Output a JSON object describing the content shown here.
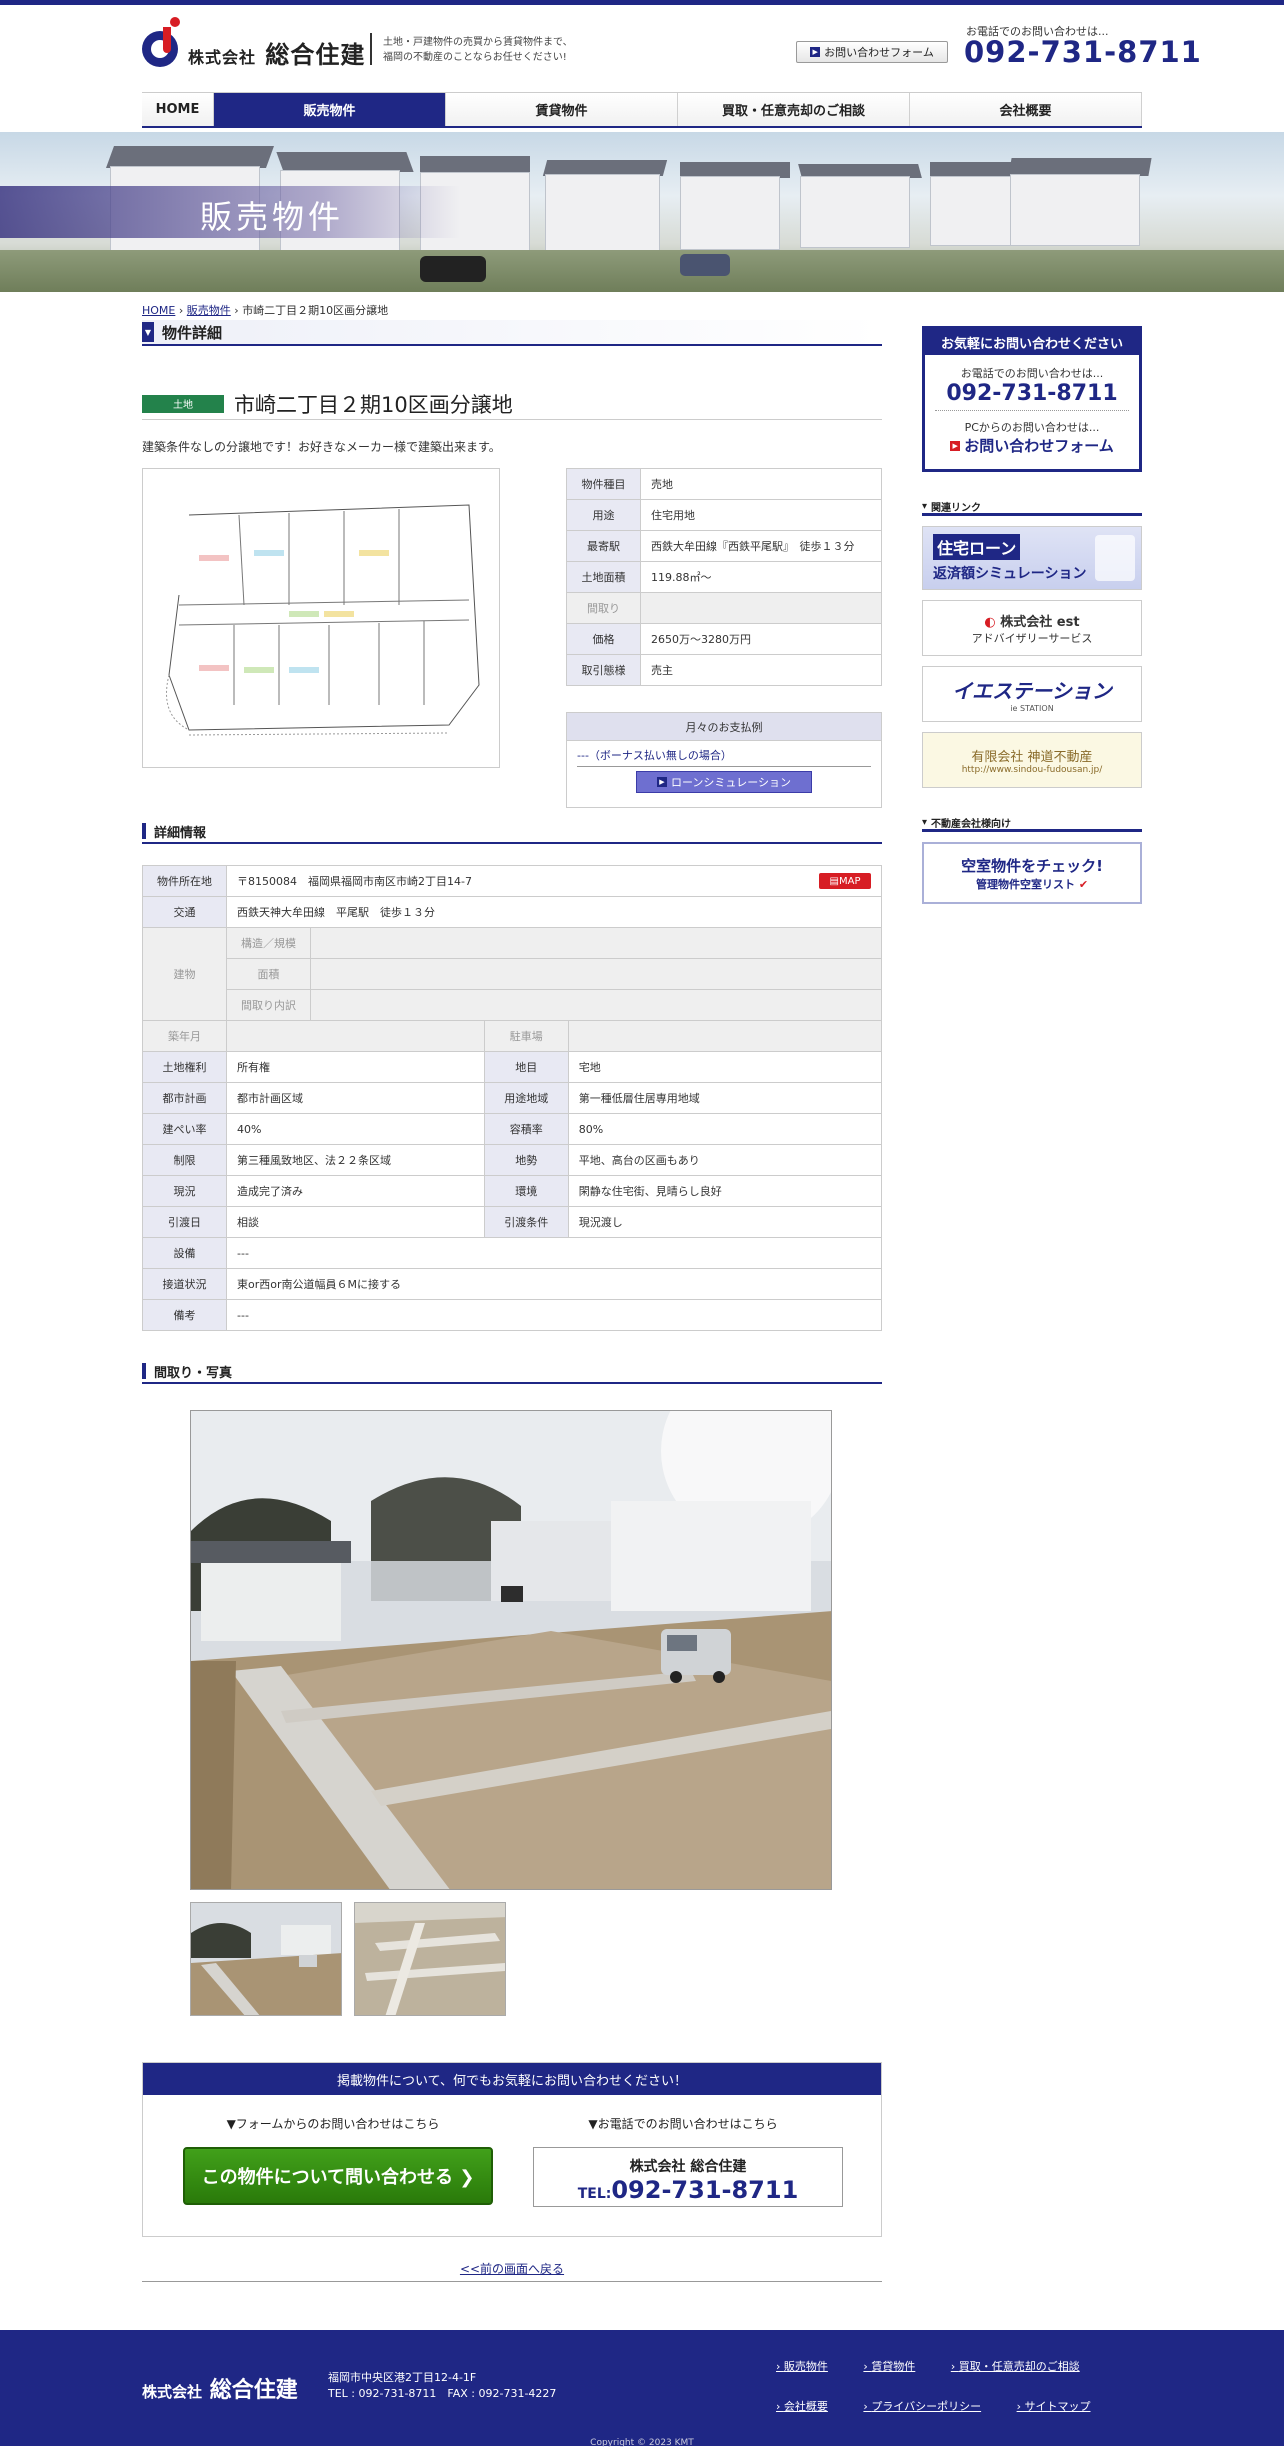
{
  "header": {
    "company_prefix": "株式会社",
    "company_name": "総合住建",
    "tagline_1": "土地・戸建物件の売買から賃貸物件まで、",
    "tagline_2": "福岡の不動産のことならお任せください!",
    "form_button": "お問い合わせフォーム",
    "tel_label": "お電話でのお問い合わせは...",
    "tel": "092-731-8711"
  },
  "nav": [
    {
      "label": "HOME",
      "active": false
    },
    {
      "label": "販売物件",
      "active": true
    },
    {
      "label": "賃貸物件",
      "active": false
    },
    {
      "label": "買取・任意売却のご相談",
      "active": false
    },
    {
      "label": "会社概要",
      "active": false
    }
  ],
  "hero": {
    "title": "販売物件"
  },
  "breadcrumb": {
    "home": "HOME",
    "category": "販売物件",
    "current": "市崎二丁目２期10区画分譲地",
    "sep": "›"
  },
  "section": {
    "title": "物件詳細"
  },
  "property": {
    "type_badge": "土地",
    "name": "市崎二丁目２期10区画分譲地",
    "catch": "建築条件なしの分譲地です！お好きなメーカー様で建築出来ます。"
  },
  "spec": [
    {
      "label": "物件種目",
      "value": "売地",
      "dim": false
    },
    {
      "label": "用途",
      "value": "住宅用地",
      "dim": false
    },
    {
      "label": "最寄駅",
      "value": "西鉄大牟田線『西鉄平尾駅』　徒歩１３分",
      "dim": false
    },
    {
      "label": "土地面積",
      "value": "119.88㎡～",
      "dim": false
    },
    {
      "label": "間取り",
      "value": "",
      "dim": true
    },
    {
      "label": "価格",
      "value": "2650万～3280万円",
      "dim": false
    },
    {
      "label": "取引態様",
      "value": "売主",
      "dim": false
    }
  ],
  "payment": {
    "title": "月々のお支払例",
    "row": "---（ボーナス払い無しの場合）",
    "button": "ローンシミュレーション"
  },
  "detail": {
    "title": "詳細情報",
    "address_label": "物件所在地",
    "address": "〒8150084　福岡県福岡市南区市崎2丁目14-7",
    "map_button": "MAP",
    "traffic_label": "交通",
    "traffic": "西鉄天神大牟田線　平尾駅　徒歩１３分",
    "building_label": "建物",
    "building_rows": [
      "構造／規模",
      "面積",
      "間取り内訳"
    ],
    "pairs": [
      {
        "l1": "築年月",
        "v1": "",
        "l2": "駐車場",
        "v2": "",
        "dim": true
      },
      {
        "l1": "土地権利",
        "v1": "所有権",
        "l2": "地目",
        "v2": "宅地",
        "dim": false
      },
      {
        "l1": "都市計画",
        "v1": "都市計画区域",
        "l2": "用途地域",
        "v2": "第一種低層住居専用地域",
        "dim": false
      },
      {
        "l1": "建ぺい率",
        "v1": "40%",
        "l2": "容積率",
        "v2": "80%",
        "dim": false
      },
      {
        "l1": "制限",
        "v1": "第三種風致地区、法２２条区域",
        "l2": "地勢",
        "v2": "平地、高台の区画もあり",
        "dim": false
      },
      {
        "l1": "現況",
        "v1": "造成完了済み",
        "l2": "環境",
        "v2": "閑静な住宅街、見晴らし良好",
        "dim": false
      },
      {
        "l1": "引渡日",
        "v1": "相談",
        "l2": "引渡条件",
        "v2": "現況渡し",
        "dim": false
      }
    ],
    "singles": [
      {
        "label": "設備",
        "value": "---"
      },
      {
        "label": "接道状況",
        "value": "東or西or南公道幅員６Mに接する"
      },
      {
        "label": "備考",
        "value": "---"
      }
    ]
  },
  "photos": {
    "title": "間取り・写真"
  },
  "cta": {
    "bar": "掲載物件について、何でもお気軽にお問い合わせください！",
    "form_label": "▼フォームからのお問い合わせはこちら",
    "form_button": "この物件について問い合わせる ❯",
    "tel_label": "▼お電話でのお問い合わせはこちら",
    "company": "株式会社 総合住建",
    "tel_prefix": "TEL:",
    "tel": "092-731-8711"
  },
  "back_link": "<<前の画面へ戻る",
  "sidebar": {
    "contact_title": "お気軽にお問い合わせください",
    "tel_label": "お電話でのお問い合わせは...",
    "tel": "092-731-8711",
    "pc_label": "PCからのお問い合わせは...",
    "form_link": "お問い合わせフォーム",
    "related_title": "関連リンク",
    "banner_loan_1": "住宅ローン",
    "banner_loan_2": "返済額シミュレーション",
    "banner_est_1": "株式会社 est",
    "banner_est_2": "アドバイザリーサービス",
    "banner_ie_1": "イエステーション",
    "banner_ie_2": "ie STATION",
    "banner_shindo_1": "有限会社 神道不動産",
    "banner_shindo_2": "http://www.sindou-fudousan.jp/",
    "biz_title": "不動産会社様向け",
    "banner_vacant_1": "空室物件をチェック!",
    "banner_vacant_2": "管理物件空室リスト"
  },
  "footer": {
    "company_prefix": "株式会社",
    "company_name": "総合住建",
    "address": "福岡市中央区港2丁目12-4-1F",
    "tel_fax": "TEL : 092-731-8711　FAX : 092-731-4227",
    "links": [
      "販売物件",
      "賃貸物件",
      "買取・任意売却のご相談",
      "会社概要",
      "プライバシーポリシー",
      "サイトマップ"
    ],
    "copyright": "Copyright © 2023 KMT"
  },
  "colors": {
    "brand": "#1f2785",
    "accent_red": "#d71d24",
    "cta_green": "#2f8a10"
  }
}
